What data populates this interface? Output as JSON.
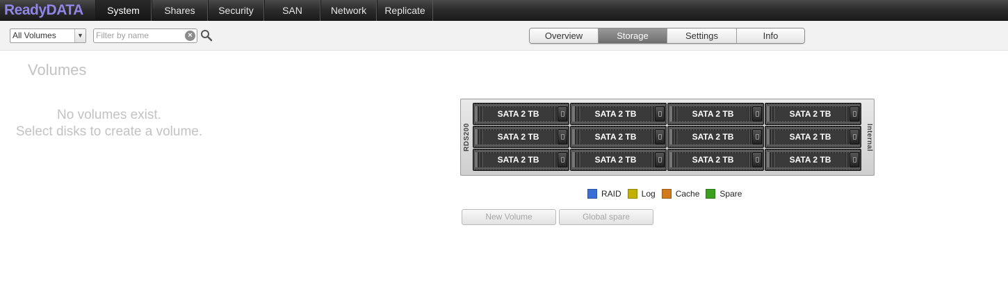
{
  "app": {
    "logo": "ReadyDATA",
    "brand_color": "#8f86e6"
  },
  "nav": {
    "tabs": [
      {
        "label": "System",
        "active": true
      },
      {
        "label": "Shares"
      },
      {
        "label": "Security"
      },
      {
        "label": "SAN"
      },
      {
        "label": "Network"
      },
      {
        "label": "Replicate"
      }
    ]
  },
  "toolbar": {
    "volume_select": {
      "value": "All Volumes"
    },
    "filter": {
      "placeholder": "Filter by name",
      "value": ""
    },
    "segments": [
      {
        "label": "Overview"
      },
      {
        "label": "Storage",
        "active": true
      },
      {
        "label": "Settings"
      },
      {
        "label": "Info"
      }
    ]
  },
  "volumes": {
    "title": "Volumes",
    "empty_line1": "No volumes exist.",
    "empty_line2": "Select disks to create a volume."
  },
  "enclosure": {
    "model": "RDS200",
    "location": "Internal",
    "disks": [
      "SATA 2 TB",
      "SATA 2 TB",
      "SATA 2 TB",
      "SATA 2 TB",
      "SATA 2 TB",
      "SATA 2 TB",
      "SATA 2 TB",
      "SATA 2 TB",
      "SATA 2 TB",
      "SATA 2 TB",
      "SATA 2 TB",
      "SATA 2 TB"
    ]
  },
  "legend": [
    {
      "label": "RAID",
      "color": "#3a6fd8"
    },
    {
      "label": "Log",
      "color": "#c2b100"
    },
    {
      "label": "Cache",
      "color": "#d07a1c"
    },
    {
      "label": "Spare",
      "color": "#3aa01e"
    }
  ],
  "actions": {
    "new_volume": "New Volume",
    "global_spare": "Global spare"
  }
}
